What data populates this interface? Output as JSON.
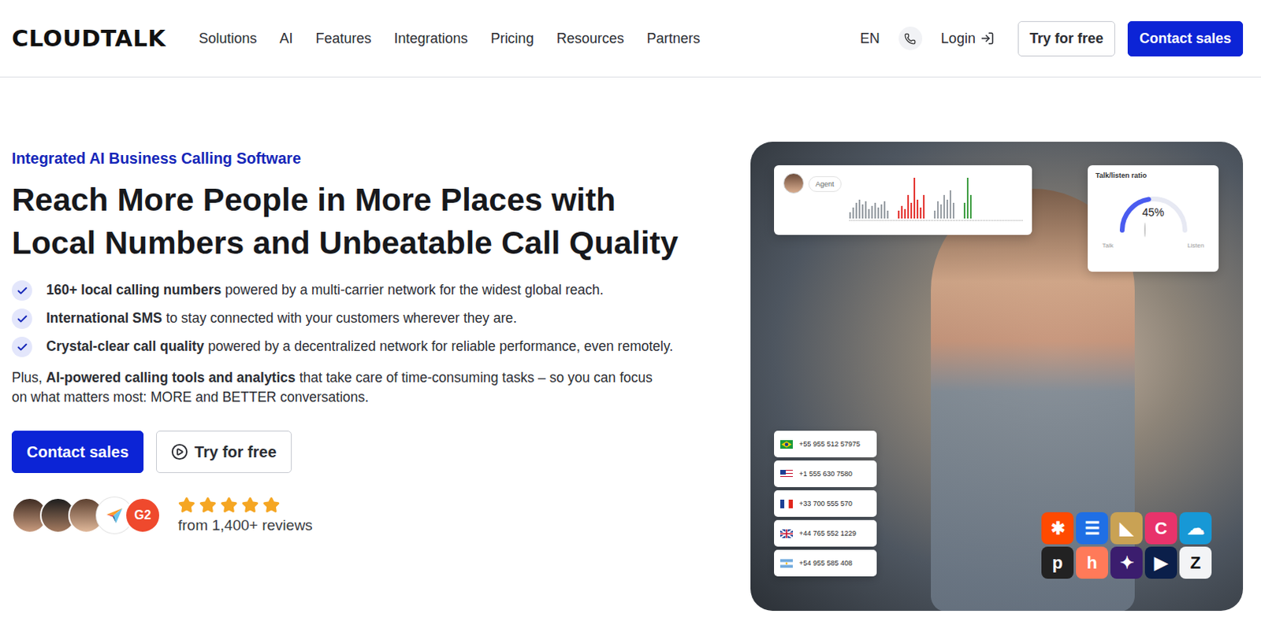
{
  "nav": {
    "logo": "CLOUDTALK",
    "items": [
      "Solutions",
      "AI",
      "Features",
      "Integrations",
      "Pricing",
      "Resources",
      "Partners"
    ],
    "language": "EN",
    "login": "Login",
    "buttons": [
      {
        "label": "Try for free",
        "kind": "secondary"
      },
      {
        "label": "Contact sales",
        "kind": "primary"
      }
    ]
  },
  "hero": {
    "eyebrow": "Integrated AI Business Calling Software",
    "title": "Reach More People in More Places with Local Numbers and Unbeatable Call Quality",
    "bullets": [
      {
        "bold": "160+ local calling numbers",
        "rest": " powered by a multi-carrier network for the widest global reach."
      },
      {
        "bold": "International SMS",
        "rest": " to stay connected with your customers wherever they are."
      },
      {
        "bold": "Crystal-clear call quality",
        "rest": " powered by a decentralized network for reliable performance, even remotely."
      }
    ],
    "plus": {
      "before": "Plus, ",
      "bold": "AI-powered calling tools and analytics",
      "after": " that take care of time-consuming tasks – so you can focus on what matters most: MORE and BETTER conversations."
    },
    "buttons": [
      {
        "label": "Contact sales",
        "kind": "primary"
      },
      {
        "label": "Try for free",
        "kind": "secondary"
      }
    ],
    "rating": {
      "badges": [
        {
          "kind": "photo"
        },
        {
          "kind": "photo"
        },
        {
          "kind": "photo"
        },
        {
          "kind": "capterra"
        },
        {
          "kind": "g2",
          "label": "G2"
        }
      ],
      "stars": 5,
      "reviews": "from 1,400+ reviews"
    }
  },
  "visual": {
    "agent_card": {
      "label": "Agent",
      "series": [
        {
          "color": "#9aa0a6",
          "values": [
            8,
            14,
            20,
            24,
            18,
            22,
            12,
            16,
            20,
            14,
            18,
            22,
            10
          ]
        },
        {
          "color": "#e53935",
          "values": [
            10,
            16,
            12,
            30,
            20,
            52,
            24,
            14,
            30
          ]
        },
        {
          "color": "#9aa0a6",
          "values": [
            10,
            22,
            18,
            30,
            24,
            36,
            20
          ]
        },
        {
          "color": "#43a047",
          "values": [
            20,
            52,
            30
          ]
        }
      ]
    },
    "ratio_card": {
      "title": "Talk/listen ratio",
      "level": 0.45,
      "reading": "45%",
      "left": "Talk",
      "right": "Listen"
    },
    "numbers": [
      {
        "number": "+55 955 512 57975",
        "kind": "br"
      },
      {
        "number": "+1 555 630 7580",
        "kind": "us"
      },
      {
        "number": "+33 700 555 570",
        "kind": "fr"
      },
      {
        "number": "+44 765 552 1229",
        "kind": "gb"
      },
      {
        "number": "+54 955 585 408",
        "kind": "ar"
      }
    ],
    "integrations": [
      {
        "color": "#ff4a00",
        "glyph": "✱"
      },
      {
        "color": "#1f6fe5",
        "glyph": "☰"
      },
      {
        "color": "#c9a254",
        "glyph": "◣"
      },
      {
        "color": "#e8336b",
        "glyph": "C"
      },
      {
        "color": "#1798d6",
        "glyph": "☁"
      },
      {
        "color": "#222222",
        "glyph": "p"
      },
      {
        "color": "#ff7a59",
        "glyph": "h"
      },
      {
        "color": "#3b1d6e",
        "glyph": "✦"
      },
      {
        "color": "#0b1f4a",
        "glyph": "▶"
      },
      {
        "color": "#f3f4f6",
        "glyph": "Z"
      }
    ]
  }
}
